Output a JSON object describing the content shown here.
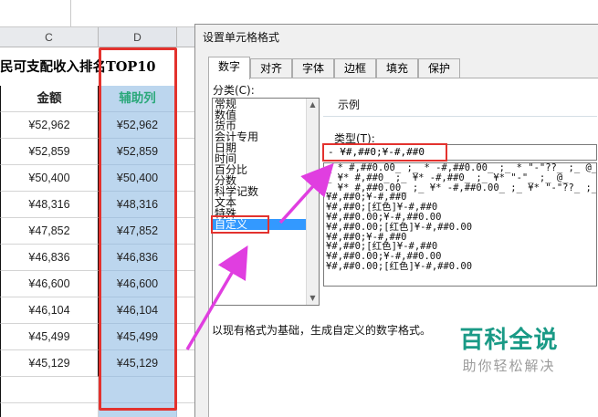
{
  "sheet": {
    "columns": [
      "C",
      "D"
    ],
    "title": "民可支配收入排名TOP10",
    "header_amount": "金额",
    "header_helper": "辅助列",
    "amounts": [
      "¥52,962",
      "¥52,859",
      "¥50,400",
      "¥48,316",
      "¥47,852",
      "¥46,836",
      "¥46,600",
      "¥46,104",
      "¥45,499",
      "¥45,129"
    ],
    "helper": [
      "¥52,962",
      "¥52,859",
      "¥50,400",
      "¥48,316",
      "¥47,852",
      "¥46,836",
      "¥46,600",
      "¥46,104",
      "¥45,499",
      "¥45,129"
    ]
  },
  "dialog": {
    "title": "设置单元格格式",
    "tabs": [
      "数字",
      "对齐",
      "字体",
      "边框",
      "填充",
      "保护"
    ],
    "category_label": "分类(C):",
    "categories": [
      "常规",
      "数值",
      "货币",
      "会计专用",
      "日期",
      "时间",
      "百分比",
      "分数",
      "科学记数",
      "文本",
      "特殊",
      "自定义"
    ],
    "selected_category": "自定义",
    "sample_label": "示例",
    "type_label": "类型(T):",
    "type_value": "- ¥#,##0;¥-#,##0",
    "formats": [
      "_ * #,##0.00_ ;_ * -#,##0.00_ ;_ * \"-\"??_ ;_ @_",
      "_ ¥* #,##0_ ;_ ¥* -#,##0_ ;_ ¥* \"-\"_ ;_ @_",
      "_ ¥* #,##0.00_ ;_ ¥* -#,##0.00_ ;_ ¥* \"-\"??_ ;_",
      "¥#,##0;¥-#,##0",
      "¥#,##0;[红色]¥-#,##0",
      "¥#,##0.00;¥-#,##0.00",
      "¥#,##0.00;[红色]¥-#,##0.00",
      "¥#,##0;¥-#,##0",
      "¥#,##0;[红色]¥-#,##0",
      "¥#,##0.00;¥-#,##0.00",
      "¥#,##0.00;[红色]¥-#,##0.00"
    ],
    "description": "以现有格式为基础，生成自定义的数字格式。"
  },
  "watermark": {
    "title": "百科全说",
    "subtitle": "助你轻松解决"
  },
  "colors": {
    "annotation_red": "#e3322e",
    "arrow_magenta": "#e03ee0",
    "helper_text": "#2aa87a",
    "selection_blue": "#3399ff",
    "watermark_teal": "#1a9a86"
  }
}
